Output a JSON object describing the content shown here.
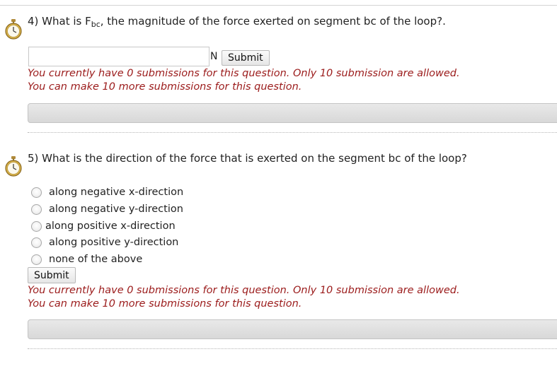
{
  "questions": [
    {
      "number_text": "4) What is F",
      "subscript": "bc",
      "rest_text": ", the magnitude of the force exerted on segment bc of the loop?.",
      "unit": "N",
      "submit_label": "Submit",
      "status_line1": "You currently have 0 submissions for this question. Only 10 submission are allowed.",
      "status_line2": "You can make 10 more submissions for this question."
    },
    {
      "text": "5) What is the direction of the force that is exerted on the segment bc of the loop?",
      "options": [
        "along negative x-direction",
        "along negative y-direction",
        "along positive x-direction",
        "along positive y-direction",
        "none of the above"
      ],
      "submit_label": "Submit",
      "status_line1": "You currently have 0 submissions for this question. Only 10 submission are allowed.",
      "status_line2": "You can make 10 more submissions for this question."
    }
  ],
  "icons": {
    "timer": "stopwatch-icon"
  },
  "colors": {
    "status_text": "#9b1b1b",
    "feedback_bar": "#dedede"
  }
}
